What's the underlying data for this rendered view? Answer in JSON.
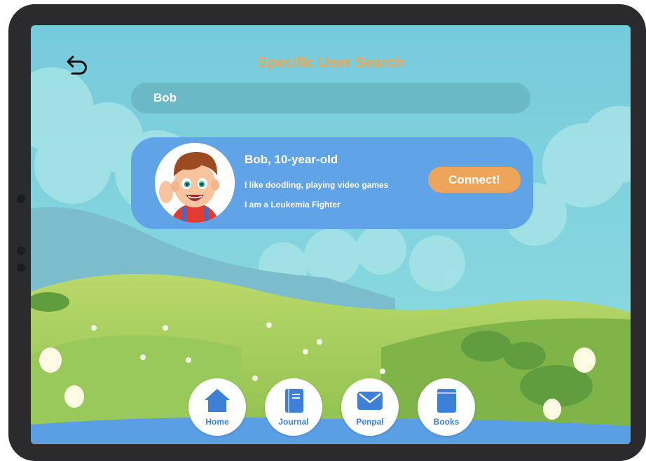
{
  "header": {
    "title": "Specific User Search"
  },
  "search": {
    "value": "Bob"
  },
  "result": {
    "name": "Bob, 10-year-old",
    "hobbies": "I like doodling, playing video games",
    "status": "I am a Leukemia Fighter",
    "connect_label": "Connect!"
  },
  "nav": {
    "items": [
      {
        "label": "Home",
        "icon": "home-icon"
      },
      {
        "label": "Journal",
        "icon": "journal-icon"
      },
      {
        "label": "Penpal",
        "icon": "envelope-icon"
      },
      {
        "label": "Books",
        "icon": "book-icon"
      }
    ]
  },
  "colors": {
    "title": "#f0a650",
    "card": "#60a3e6",
    "connect": "#eda55a",
    "nav_text": "#3e7fd8",
    "sky": "#7fd0dc"
  }
}
